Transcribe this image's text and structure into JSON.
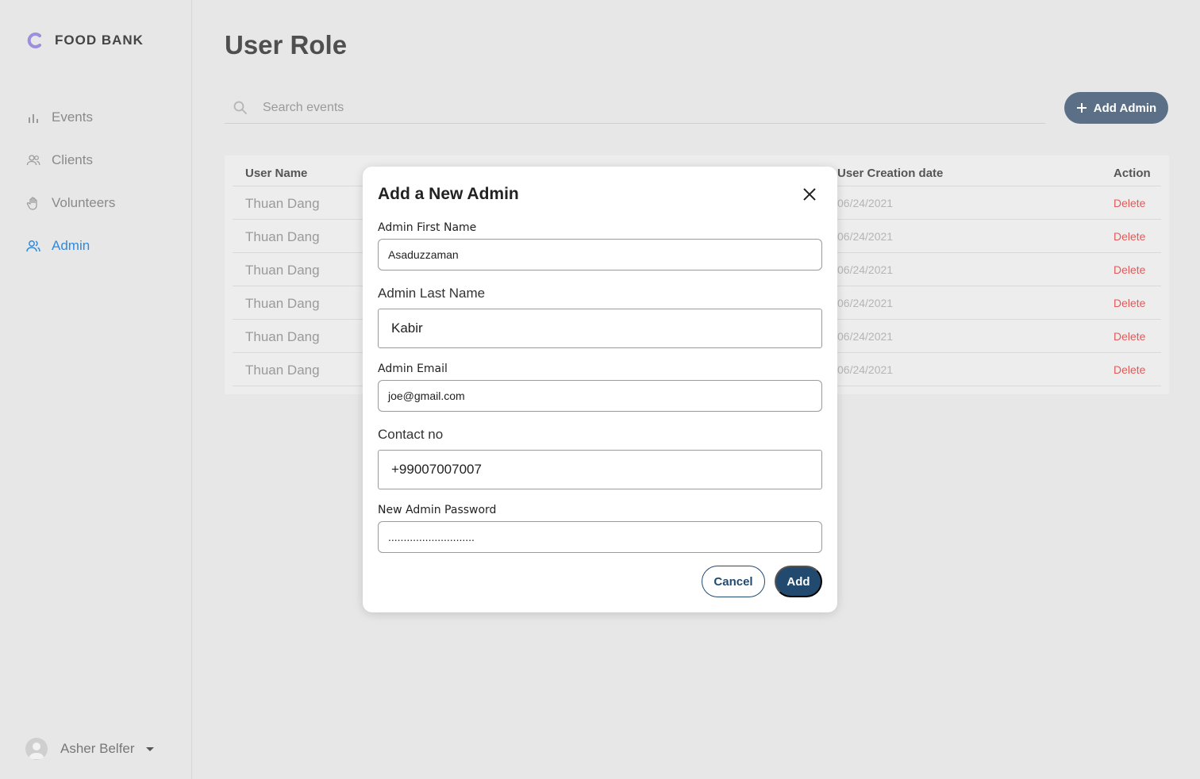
{
  "brand": {
    "name": "FOOD BANK"
  },
  "sidebar": {
    "items": [
      {
        "label": "Events",
        "icon": "bar-chart-icon"
      },
      {
        "label": "Clients",
        "icon": "users-icon"
      },
      {
        "label": "Volunteers",
        "icon": "hand-icon"
      },
      {
        "label": "Admin",
        "icon": "admin-users-icon",
        "active": true
      }
    ],
    "user": {
      "name": "Asher Belfer"
    }
  },
  "page": {
    "title": "User Role"
  },
  "search": {
    "placeholder": "Search events"
  },
  "toolbar": {
    "add_admin_label": "Add Admin"
  },
  "table": {
    "headers": {
      "user_name": "User Name",
      "creation_date": "User Creation date",
      "action": "Action"
    },
    "rows": [
      {
        "name": "Thuan Dang",
        "date": "06/24/2021",
        "action": "Delete"
      },
      {
        "name": "Thuan Dang",
        "date": "06/24/2021",
        "action": "Delete"
      },
      {
        "name": "Thuan Dang",
        "date": "06/24/2021",
        "action": "Delete"
      },
      {
        "name": "Thuan Dang",
        "date": "06/24/2021",
        "action": "Delete"
      },
      {
        "name": "Thuan Dang",
        "date": "06/24/2021",
        "action": "Delete"
      },
      {
        "name": "Thuan Dang",
        "date": "06/24/2021",
        "action": "Delete"
      }
    ]
  },
  "modal": {
    "title": "Add a New Admin",
    "first_name_label": "Admin First Name",
    "first_name_value": "Asaduzzaman",
    "last_name_label": "Admin Last Name",
    "last_name_value": "Kabir",
    "email_label": "Admin Email",
    "email_value": "joe@gmail.com",
    "contact_label": "Contact no",
    "contact_value": "+99007007007",
    "password_label": "New Admin Password",
    "password_value": "............................",
    "cancel_label": "Cancel",
    "add_label": "Add"
  },
  "colors": {
    "accent": "#2d8adf",
    "primary": "#224a6e",
    "danger": "#e05a5a"
  }
}
